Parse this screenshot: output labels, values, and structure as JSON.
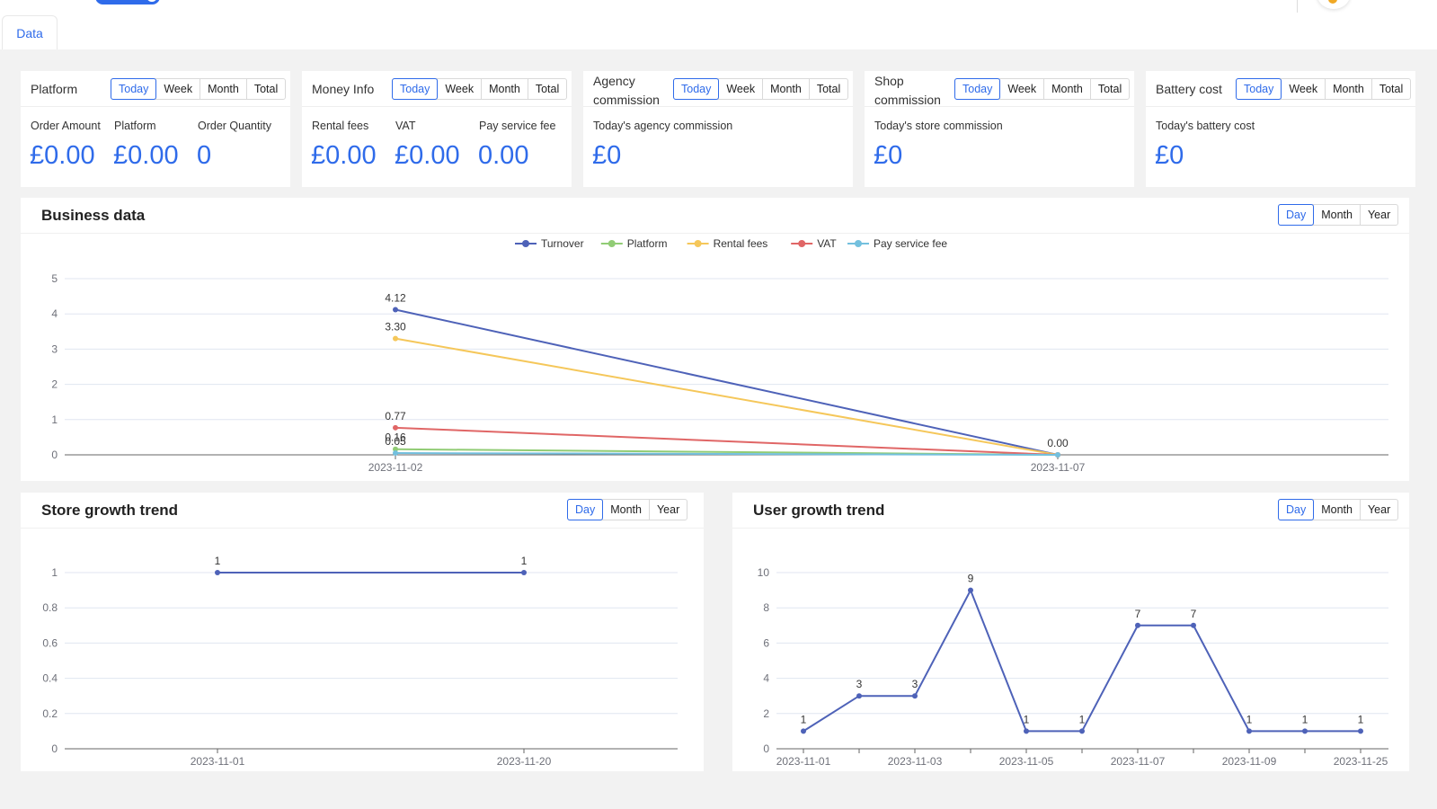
{
  "tabs": [
    {
      "label": "Data",
      "active": true
    }
  ],
  "accent": "#2f6bea",
  "period_options": [
    "Today",
    "Week",
    "Month",
    "Total"
  ],
  "chart_period_options": [
    "Day",
    "Month",
    "Year"
  ],
  "cards": [
    {
      "title": "Platform",
      "selected": "Today",
      "stats": [
        {
          "label": "Order Amount",
          "value": "£0.00"
        },
        {
          "label": "Platform",
          "value": "£0.00"
        },
        {
          "label": "Order Quantity",
          "value": "0"
        }
      ]
    },
    {
      "title": "Money Info",
      "selected": "Today",
      "stats": [
        {
          "label": "Rental fees",
          "value": "£0.00"
        },
        {
          "label": "VAT",
          "value": "£0.00"
        },
        {
          "label": "Pay service fee",
          "value": "0.00"
        }
      ]
    },
    {
      "title": "Agency commission",
      "selected": "Today",
      "stats": [
        {
          "label": "Today's agency commission",
          "value": "£0"
        }
      ]
    },
    {
      "title": "Shop commission",
      "selected": "Today",
      "stats": [
        {
          "label": "Today's store commission",
          "value": "£0"
        }
      ]
    },
    {
      "title": "Battery cost",
      "selected": "Today",
      "stats": [
        {
          "label": "Today's battery cost",
          "value": "£0"
        }
      ]
    }
  ],
  "chart_data": [
    {
      "title": "Business data",
      "type": "line",
      "selected": "Day",
      "categories": [
        "2023-11-02",
        "2023-11-07"
      ],
      "ylim": [
        0,
        5
      ],
      "yticks": [
        0,
        1,
        2,
        3,
        4,
        5
      ],
      "grid": true,
      "legend": "top-center",
      "series": [
        {
          "name": "Turnover",
          "color": "#4e62b8",
          "values": [
            4.12,
            0.0
          ],
          "labels": [
            "4.12",
            "0.00"
          ]
        },
        {
          "name": "Platform",
          "color": "#91cc75",
          "values": [
            0.16,
            0.0
          ],
          "labels": [
            "0.16",
            ""
          ]
        },
        {
          "name": "Rental fees",
          "color": "#f5c75a",
          "values": [
            3.3,
            0.0
          ],
          "labels": [
            "3.30",
            ""
          ]
        },
        {
          "name": "VAT",
          "color": "#e06666",
          "values": [
            0.77,
            0.0
          ],
          "labels": [
            "0.77",
            ""
          ]
        },
        {
          "name": "Pay service fee",
          "color": "#73c0de",
          "values": [
            0.05,
            0.0
          ],
          "labels": [
            "0.05",
            ""
          ]
        }
      ]
    },
    {
      "title": "Store growth trend",
      "type": "line",
      "selected": "Day",
      "categories": [
        "2023-11-01",
        "2023-11-20"
      ],
      "ylim": [
        0,
        1
      ],
      "yticks": [
        0,
        0.2,
        0.4,
        0.6,
        0.8,
        1
      ],
      "grid": true,
      "series": [
        {
          "color": "#4e62b8",
          "values": [
            1,
            1
          ],
          "labels": [
            "1",
            "1"
          ]
        }
      ]
    },
    {
      "title": "User growth trend",
      "type": "line",
      "selected": "Day",
      "categories": [
        "2023-11-01",
        "",
        "2023-11-03",
        "",
        "2023-11-05",
        "",
        "2023-11-07",
        "",
        "2023-11-09",
        "",
        "2023-11-25"
      ],
      "ylim": [
        0,
        10
      ],
      "yticks": [
        0,
        2,
        4,
        6,
        8,
        10
      ],
      "grid": true,
      "series": [
        {
          "color": "#4e62b8",
          "values": [
            1,
            3,
            3,
            9,
            1,
            1,
            7,
            7,
            1,
            1,
            1
          ],
          "labels": [
            "1",
            "3",
            "3",
            "9",
            "1",
            "1",
            "7",
            "7",
            "1",
            "1",
            "1"
          ]
        }
      ]
    }
  ]
}
